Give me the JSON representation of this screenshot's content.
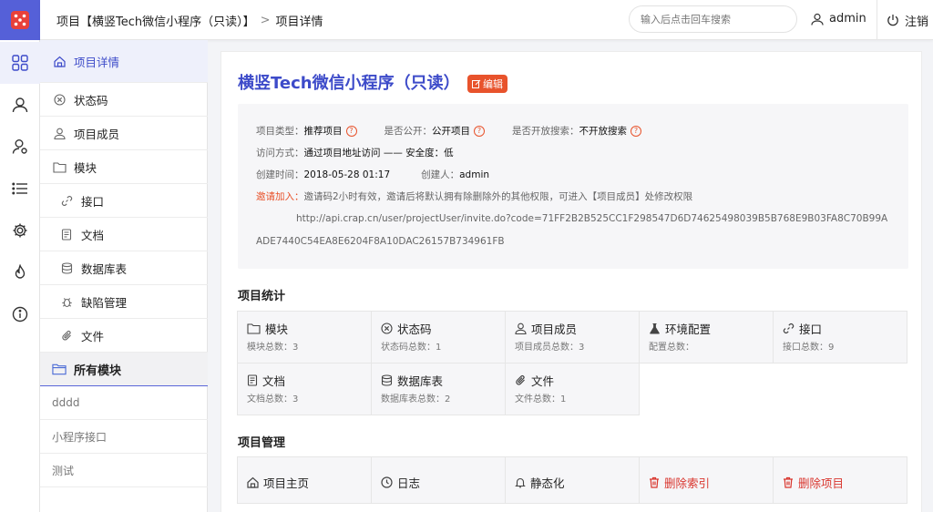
{
  "header": {
    "breadcrumb_project": "项目【横竖Tech微信小程序（只读）】",
    "breadcrumb_sep": ">",
    "breadcrumb_current": "项目详情",
    "search_placeholder": "输入后点击回车搜索",
    "user_name": "admin",
    "logout_label": "注销"
  },
  "rail": {
    "icons": [
      "logo-icon",
      "dashboard-grid-icon",
      "user-icon",
      "user-settings-icon",
      "list-icon",
      "gear-icon",
      "fire-icon",
      "info-icon"
    ]
  },
  "sidebar": {
    "items": [
      {
        "label": "项目详情",
        "icon": "home-icon"
      },
      {
        "label": "状态码",
        "icon": "close-circle-icon"
      },
      {
        "label": "项目成员",
        "icon": "user-icon"
      },
      {
        "label": "模块",
        "icon": "folder-icon"
      },
      {
        "label": "接口",
        "icon": "link-icon"
      },
      {
        "label": "文档",
        "icon": "document-icon"
      },
      {
        "label": "数据库表",
        "icon": "database-icon"
      },
      {
        "label": "缺陷管理",
        "icon": "bug-icon"
      },
      {
        "label": "文件",
        "icon": "paperclip-icon"
      },
      {
        "label": "所有模块",
        "icon": "folder-open-icon"
      },
      {
        "label": "dddd"
      },
      {
        "label": "小程序接口"
      },
      {
        "label": "测试"
      }
    ]
  },
  "project": {
    "title": "横竖Tech微信小程序（只读）",
    "edit_label": "编辑",
    "type_label": "项目类型：",
    "type_value": "推荐项目",
    "public_label": "是否公开：",
    "public_value": "公开项目",
    "search_label": "是否开放搜索：",
    "search_value": "不开放搜索",
    "access_label": "访问方式：",
    "access_value": "通过项目地址访问 —— 安全度：低",
    "created_label": "创建时间：",
    "created_value": "2018-05-28 01:17",
    "creator_label": "创建人：",
    "creator_value": "admin",
    "invite_label": "邀请加入：",
    "invite_text": "邀请码2小时有效，邀请后将默认拥有除删除外的其他权限，可进入【项目成员】处修改权限",
    "invite_url_1": "http://api.crap.cn/user/projectUser/invite.do?code=71FF2B2B525CC1F298547D6D74625498039B5B768E9B03FA8C70B99A",
    "invite_url_2": "ADE7440C54EA8E6204F8A10DAC26157B734961FB"
  },
  "stats": {
    "title": "项目统计",
    "items": [
      {
        "label": "模块",
        "sub": "模块总数：3",
        "icon": "folder-icon"
      },
      {
        "label": "状态码",
        "sub": "状态码总数：1",
        "icon": "close-circle-icon"
      },
      {
        "label": "项目成员",
        "sub": "项目成员总数：3",
        "icon": "user-icon"
      },
      {
        "label": "环境配置",
        "sub": "配置总数：",
        "icon": "flask-icon"
      },
      {
        "label": "接口",
        "sub": "接口总数：9",
        "icon": "link-icon"
      },
      {
        "label": "文档",
        "sub": "文档总数：3",
        "icon": "document-icon"
      },
      {
        "label": "数据库表",
        "sub": "数据库表总数：2",
        "icon": "database-icon"
      },
      {
        "label": "文件",
        "sub": "文件总数：1",
        "icon": "paperclip-icon"
      }
    ]
  },
  "management": {
    "title": "项目管理",
    "items": [
      {
        "label": "项目主页",
        "icon": "home-icon"
      },
      {
        "label": "日志",
        "icon": "clock-icon"
      },
      {
        "label": "静态化",
        "icon": "bell-icon"
      },
      {
        "label": "删除索引",
        "icon": "trash-icon"
      },
      {
        "label": "删除项目",
        "icon": "trash-icon"
      }
    ]
  },
  "colors": {
    "accent": "#3d4bc9",
    "logo_bg": "#5560d8",
    "danger": "#e8532c"
  }
}
